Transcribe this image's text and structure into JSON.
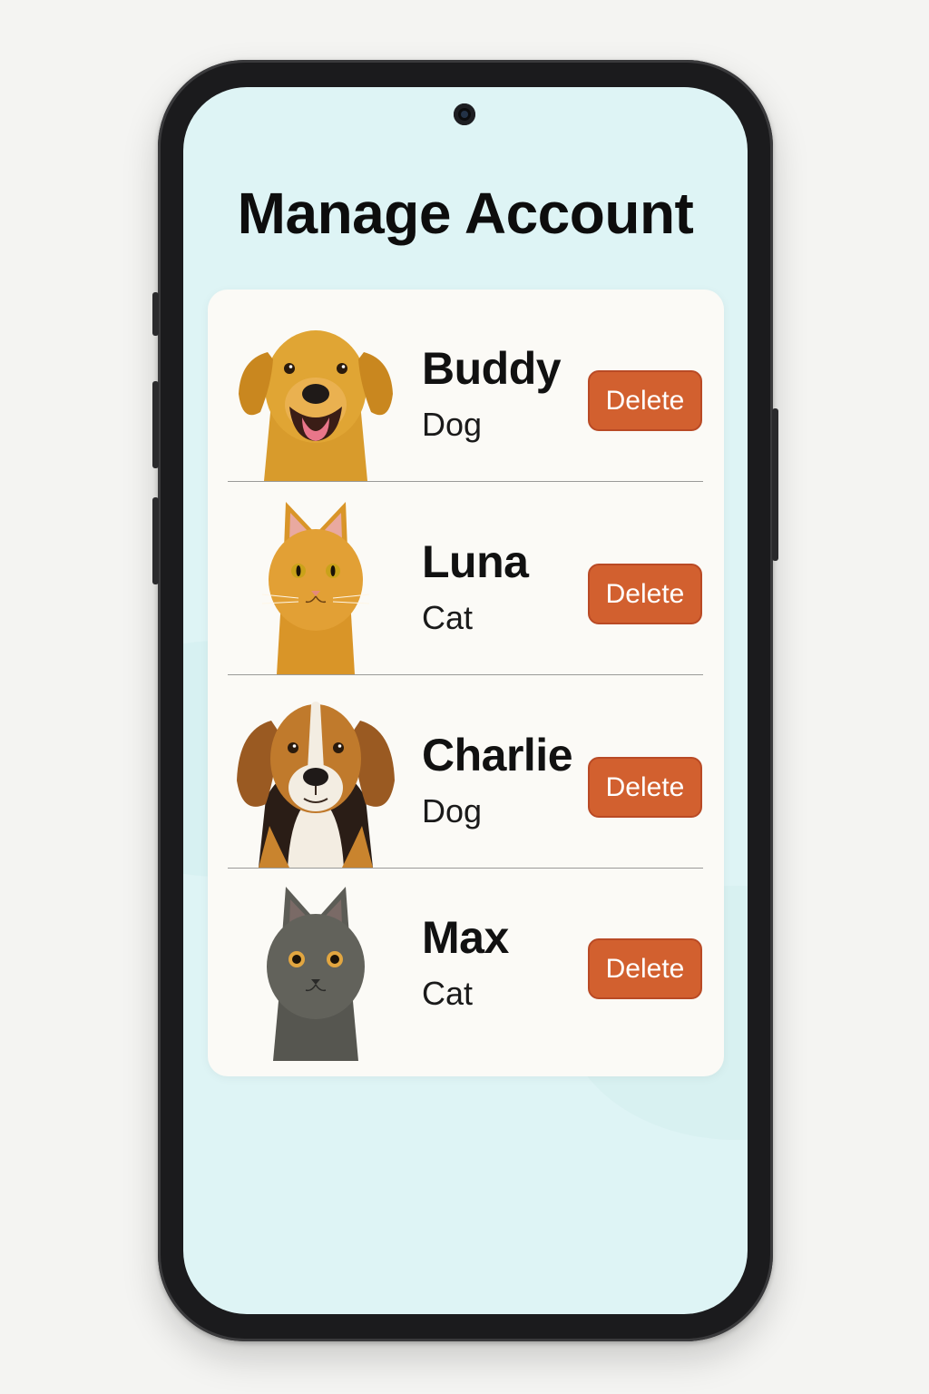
{
  "app": {
    "title": "Manage Account"
  },
  "pets": [
    {
      "name": "Buddy",
      "type": "Dog",
      "delete_label": "Delete"
    },
    {
      "name": "Luna",
      "type": "Cat",
      "delete_label": "Delete"
    },
    {
      "name": "Charlie",
      "type": "Dog",
      "delete_label": "Delete"
    },
    {
      "name": "Max",
      "type": "Cat",
      "delete_label": "Delete"
    }
  ],
  "colors": {
    "screen_background": "#def4f5",
    "card_background": "#fbfaf6",
    "delete_button": "#d2602f",
    "delete_button_border": "#b94a25",
    "text": "#111111"
  },
  "icons": {
    "pet_0": "golden-retriever-portrait",
    "pet_1": "orange-tabby-cat-portrait",
    "pet_2": "beagle-portrait",
    "pet_3": "gray-cat-portrait"
  }
}
